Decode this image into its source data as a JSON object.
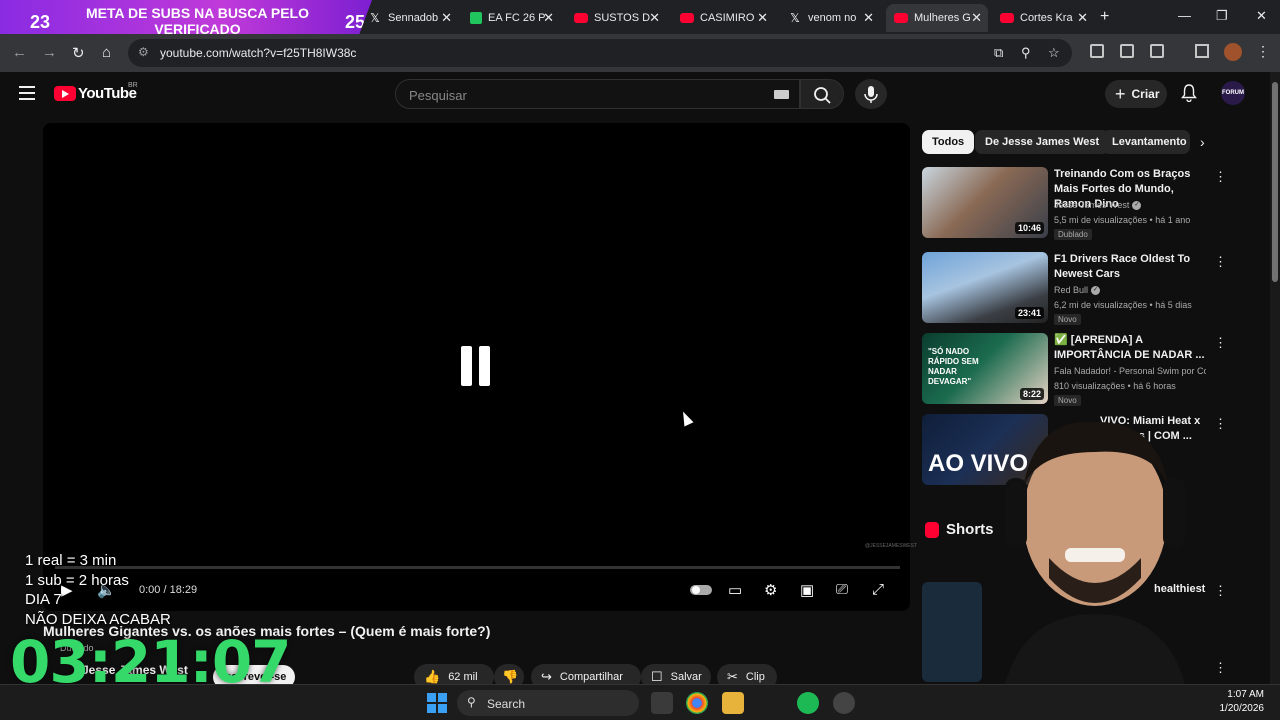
{
  "browser": {
    "tabs": [
      {
        "title": "Sennadob",
        "icon": "x-logo-icon"
      },
      {
        "title": "EA FC 26 P",
        "icon": "green-app-icon"
      },
      {
        "title": "SUSTOS D",
        "icon": "youtube-icon"
      },
      {
        "title": "CASIMIRO",
        "icon": "youtube-icon"
      },
      {
        "title": "venom no",
        "icon": "x-logo-icon"
      },
      {
        "title": "Mulheres G",
        "icon": "youtube-icon"
      },
      {
        "title": "Cortes Kra",
        "icon": "youtube-icon"
      }
    ],
    "url": "youtube.com/watch?v=f25TH8IW38c"
  },
  "overlay": {
    "goal_left": "23",
    "goal_right": "25",
    "goal_message": "META DE SUBS NA BUSCA PELO VERIFICADO",
    "line1": "1 real = 3 min",
    "line2": "1 sub = 2 horas",
    "line3": "DIA 7",
    "line4": "NÃO DEIXA ACABAR",
    "timer": "03:21:07"
  },
  "youtube": {
    "logo_text": "YouTube",
    "country": "BR",
    "search_placeholder": "Pesquisar",
    "create_label": "Criar",
    "avatar_text": "FORUM"
  },
  "video": {
    "time": "0:00 / 18:29",
    "title": "Mulheres Gigantes vs. os anões mais fortes – (Quem é mais forte?)",
    "dub_label": "Dublado",
    "channel": "Jesse James West",
    "subscribe": "Inscrever-se",
    "likes": "62 mil",
    "share": "Compartilhar",
    "save": "Salvar",
    "clip": "Clip",
    "watermark": "@JESSEJAMESWEST"
  },
  "sidebar": {
    "chips": [
      "Todos",
      "De Jesse James West",
      "Levantamento d"
    ],
    "recs": [
      {
        "title": "Treinando Com os Braços Mais Fortes do Mundo, Ramon Dino",
        "channel": "Jesse James West",
        "meta": "5,5 mi de visualizações • há 1 ano",
        "badge": "Dublado",
        "duration": "10:46"
      },
      {
        "title": "F1 Drivers Race Oldest To Newest Cars",
        "channel": "Red Bull",
        "meta": "6,2 mi de visualizações • há 5 dias",
        "badge": "Novo",
        "duration": "23:41"
      },
      {
        "title": "✅ [APRENDA] A IMPORTÂNCIA DE NADAR ...",
        "channel": "Fala Nadador! - Personal Swim por Conr...",
        "meta": "810 visualizações • há 6 horas",
        "badge": "Novo",
        "duration": "8:22",
        "thumb_text": "\"SÓ NADO RÁPIDO SEM NADAR DEVAGAR\""
      },
      {
        "title": "VIVO: Miami Heat x Warriors | COM ...",
        "thumb_text": "AO VIVO"
      }
    ],
    "shorts_label": "Shorts",
    "shorts_first_title": "healthiest"
  },
  "taskbar": {
    "search": "Search",
    "time": "1:07 AM",
    "date": "1/20/2026"
  },
  "colors": {
    "youtube_red": "#ff0033",
    "timer_green": "#35d96a",
    "goal_purple": "#c03ad9"
  }
}
